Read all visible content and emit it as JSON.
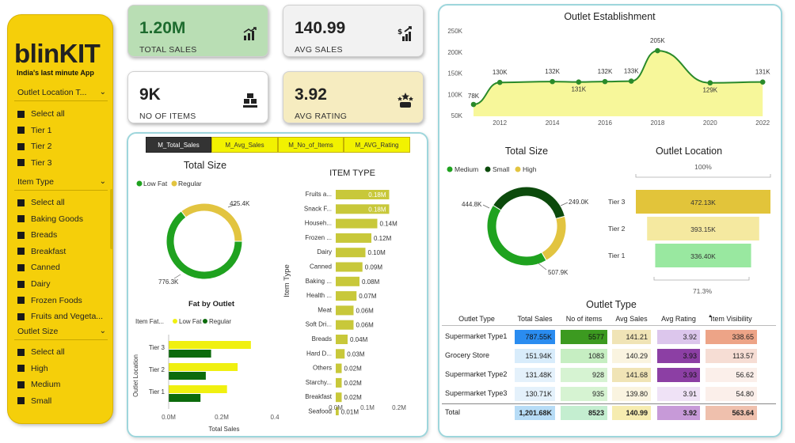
{
  "brand": {
    "name": "blinKIT",
    "tagline": "India's last minute App"
  },
  "slicers": [
    {
      "title": "Outlet Location T...",
      "items": [
        "Select all",
        "Tier 1",
        "Tier 2",
        "Tier 3"
      ]
    },
    {
      "title": "Item Type",
      "items": [
        "Select all",
        "Baking Goods",
        "Breads",
        "Breakfast",
        "Canned",
        "Dairy",
        "Frozen Foods",
        "Fruits and Vegeta..."
      ]
    },
    {
      "title": "Outlet Size",
      "items": [
        "Select all",
        "High",
        "Medium",
        "Small"
      ]
    }
  ],
  "kpis": [
    {
      "value": "1.20M",
      "label": "TOTAL SALES",
      "icon": "bar-chart-icon",
      "bg": "#b9deb4",
      "color": "#1d6b2e"
    },
    {
      "value": "140.99",
      "label": "AVG SALES",
      "icon": "money-growth-icon",
      "bg": "#f2f2f2",
      "color": "#222222"
    },
    {
      "value": "9K",
      "label": "NO OF ITEMS",
      "icon": "boxes-icon",
      "bg": "#ffffff",
      "color": "#222222"
    },
    {
      "value": "3.92",
      "label": "AVG RATING",
      "icon": "rating-stars-icon",
      "bg": "#f6ecc0",
      "color": "#222222"
    }
  ],
  "tabs": [
    "M_Total_Sales",
    "M_Avg_Sales",
    "M_No_of_Items",
    "M_AVG_Rating"
  ],
  "colors": {
    "yellow": "#f0f010",
    "green": "#1a9c1a",
    "darkgreen": "#0c5a0c",
    "gold": "#e0c43a",
    "olive": "#c8c83a",
    "lightyellow": "#f7f79a"
  },
  "chart_data": [
    {
      "type": "pie",
      "title": "Total Size",
      "legend": [
        "Low Fat",
        "Regular"
      ],
      "labels": [
        "Low Fat",
        "Regular"
      ],
      "values": [
        776.3,
        425.4
      ],
      "data_labels": [
        "776.3K",
        "425.4K"
      ],
      "colors": [
        "#1fa21f",
        "#e2c440"
      ]
    },
    {
      "type": "bar",
      "title": "ITEM TYPE",
      "ylabel": "Item Type",
      "categories": [
        "Fruits a...",
        "Snack F...",
        "Househ...",
        "Frozen ...",
        "Dairy",
        "Canned",
        "Baking ...",
        "Health ...",
        "Meat",
        "Soft Dri...",
        "Breads",
        "Hard D...",
        "Others",
        "Starchy...",
        "Breakfast",
        "Seafood"
      ],
      "values": [
        0.18,
        0.18,
        0.14,
        0.12,
        0.1,
        0.09,
        0.08,
        0.07,
        0.06,
        0.06,
        0.04,
        0.03,
        0.02,
        0.02,
        0.02,
        0.01
      ],
      "data_labels": [
        "0.18M",
        "0.18M",
        "0.14M",
        "0.12M",
        "0.10M",
        "0.09M",
        "0.08M",
        "0.07M",
        "0.06M",
        "0.06M",
        "0.04M",
        "0.03M",
        "0.02M",
        "0.02M",
        "0.02M",
        "0.01M"
      ],
      "xticks": [
        "0.0M",
        "0.1M",
        "0.2M"
      ],
      "xlim": [
        0,
        0.2
      ]
    },
    {
      "type": "bar",
      "title": "Fat by Outlet",
      "legend_title": "Item Fat...",
      "xlabel": "Total Sales",
      "ylabel": "Outlet Location",
      "categories": [
        "Tier 3",
        "Tier 2",
        "Tier 1"
      ],
      "series": [
        {
          "name": "Low Fat",
          "values": [
            0.31,
            0.26,
            0.22
          ],
          "color": "#f0f010"
        },
        {
          "name": "Regular",
          "values": [
            0.16,
            0.14,
            0.12
          ],
          "color": "#0c6b0c"
        }
      ],
      "xticks": [
        "0.0M",
        "0.2M",
        "0.4"
      ],
      "xlim": [
        0,
        0.4
      ]
    },
    {
      "type": "area",
      "title": "Outlet Establishment",
      "x": [
        2011,
        2012,
        2014,
        2015,
        2016,
        2017,
        2018,
        2020,
        2022
      ],
      "values": [
        78,
        130,
        132,
        131,
        132,
        133,
        205,
        129,
        131
      ],
      "data_labels": [
        "78K",
        "130K",
        "132K",
        "131K",
        "132K",
        "133K",
        "205K",
        "129K",
        "131K"
      ],
      "yticks": [
        "250K",
        "200K",
        "150K",
        "100K",
        "50K"
      ],
      "xticks": [
        "2012",
        "2014",
        "2016",
        "2018",
        "2020",
        "2022"
      ],
      "ylim": [
        50,
        250
      ]
    },
    {
      "type": "pie",
      "title": "Total Size",
      "legend": [
        "Medium",
        "Small",
        "High"
      ],
      "labels": [
        "Medium",
        "Small",
        "High"
      ],
      "values": [
        507.9,
        444.8,
        249.0
      ],
      "data_labels": [
        "507.9K",
        "444.8K",
        "249.0K"
      ],
      "colors": [
        "#1fa21f",
        "#0c4a0c",
        "#e2c440"
      ]
    },
    {
      "type": "bar",
      "title": "Outlet Location",
      "categories": [
        "Tier 3",
        "Tier 2",
        "Tier 1"
      ],
      "values": [
        472.13,
        393.15,
        336.4
      ],
      "data_labels": [
        "472.13K",
        "393.15K",
        "336.40K"
      ],
      "top_pct": "100%",
      "bottom_pct": "71.3%",
      "colors": [
        "#e2c43a",
        "#f5e9a0",
        "#99e8a0"
      ]
    },
    {
      "type": "table",
      "title": "Outlet Type",
      "columns": [
        "Outlet Type",
        "Total Sales",
        "No of items",
        "Avg Sales",
        "Avg Rating",
        "Item Visibility"
      ],
      "rows": [
        [
          "Supermarket Type1",
          "787.55K",
          "5577",
          "141.21",
          "3.92",
          "338.65"
        ],
        [
          "Grocery Store",
          "151.94K",
          "1083",
          "140.29",
          "3.93",
          "113.57"
        ],
        [
          "Supermarket Type2",
          "131.48K",
          "928",
          "141.68",
          "3.93",
          "56.62"
        ],
        [
          "Supermarket Type3",
          "130.71K",
          "935",
          "139.80",
          "3.91",
          "54.80"
        ]
      ],
      "total": [
        "Total",
        "1,201.68K",
        "8523",
        "140.99",
        "3.92",
        "563.64"
      ]
    }
  ]
}
